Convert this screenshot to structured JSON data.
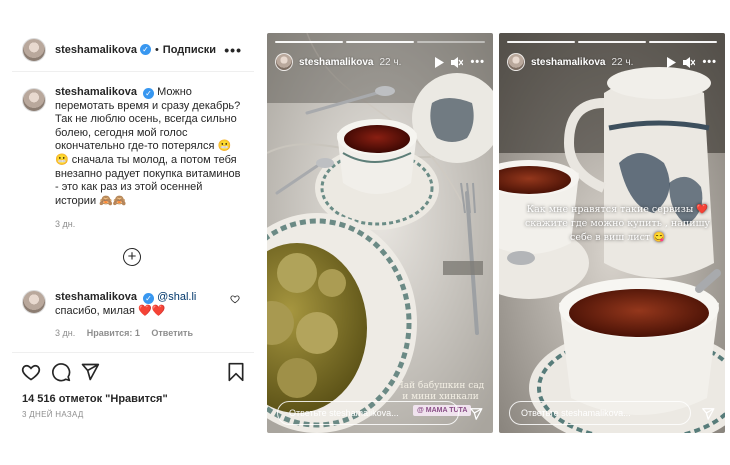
{
  "post": {
    "username": "steshamalikova",
    "follow_label": "Подписки",
    "caption": "Можно перемотать время и сразу декабрь? Так не люблю осень, всегда сильно болею, сегодня мой голос окончательно где-то потерялся 😬😬 сначала ты молод, а потом тебя внезапно радует покупка витаминов - это как раз из этой осенней истории 🙈🙈",
    "caption_time": "3 дн.",
    "comment": {
      "username": "steshamalikova",
      "mention": "@shal.li",
      "text": "спасибо, милая",
      "hearts": "❤️❤️",
      "time": "3 дн.",
      "likes": "Нравится: 1",
      "reply": "Ответить"
    },
    "likes_count": "14 516 отметок \"Нравится\"",
    "days_ago": "3 ДНЕЙ НАЗАД",
    "icons": [
      "heart-icon",
      "comment-icon",
      "share-icon",
      "bookmark-icon",
      "more-icon",
      "plus-circle-icon"
    ]
  },
  "stories": [
    {
      "username": "steshamalikova",
      "time": "22 ч.",
      "reply_placeholder": "Ответьте steshamalikova...",
      "caption": "Чай бабушкин сад и мини хинкали",
      "tag": "@ MAMA TUTA"
    },
    {
      "username": "steshamalikova",
      "time": "22 ч.",
      "reply_placeholder": "Ответьте steshamalikova...",
      "caption": "Как мне нравятся такие сервизы ❤️ скажите где можно купить , напишу себе в виш лист 😋"
    }
  ],
  "colors": {
    "accent": "#3897f0",
    "heart": "#ed1c24",
    "muted": "#8e8e8e",
    "mention": "#00376b"
  }
}
